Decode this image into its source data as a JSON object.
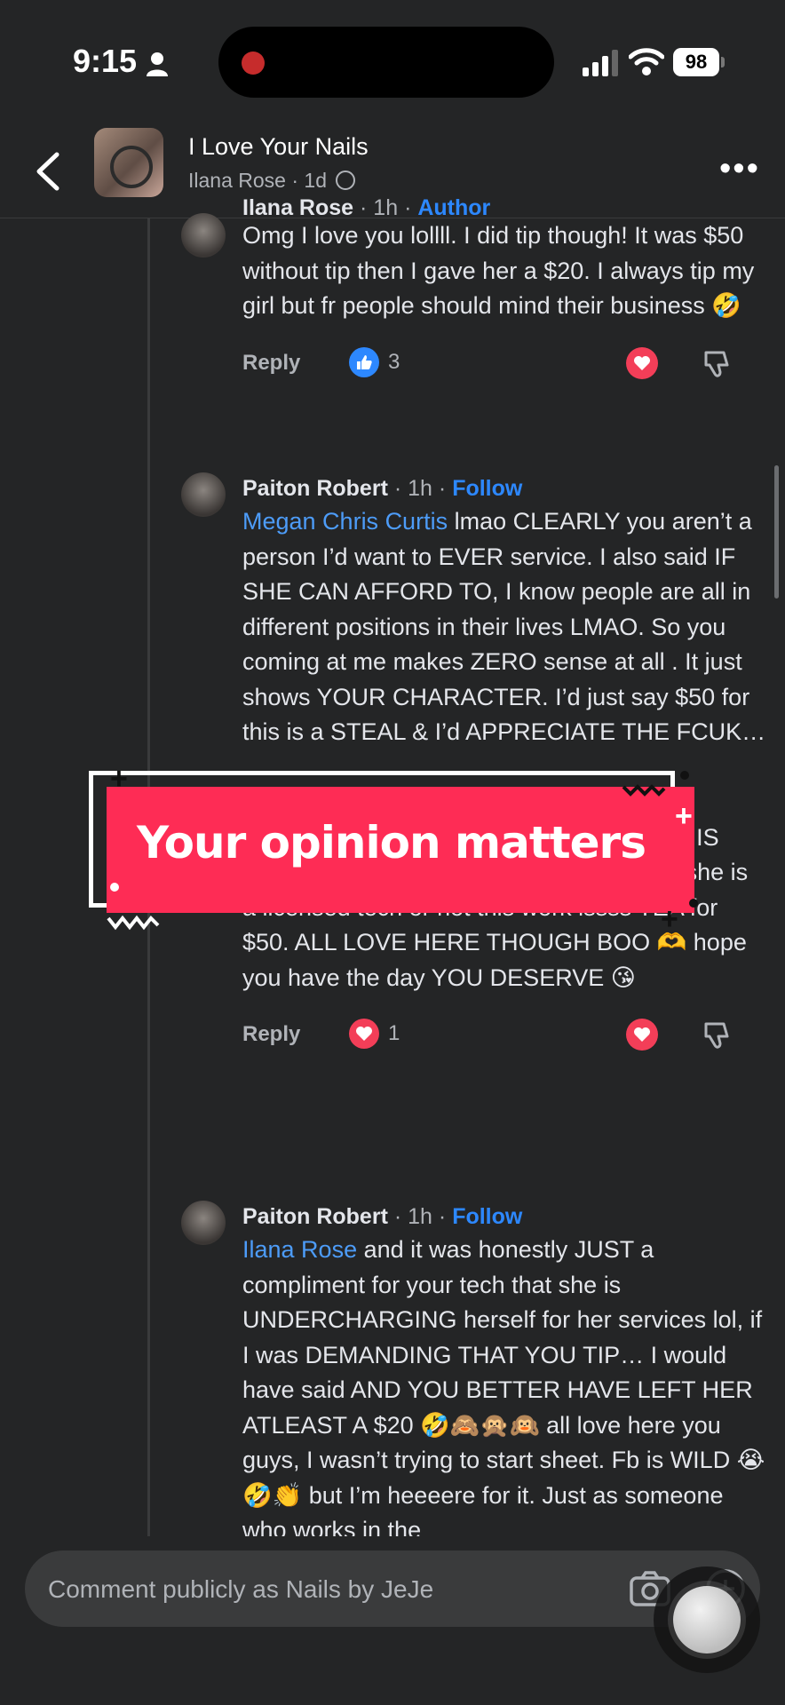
{
  "status_bar": {
    "time": "9:15",
    "battery": "98"
  },
  "header": {
    "title": "I Love Your Nails",
    "author": "Ilana Rose",
    "age": "1d"
  },
  "comments": [
    {
      "author": "Ilana Rose",
      "age": "1h",
      "badge": "Author",
      "text": "Omg I love you lollll. I did tip though! It was $50 without tip then I gave her a $20. I always tip my girl but fr people should mind their business 🤣",
      "reply_label": "Reply",
      "reaction_count": "3"
    },
    {
      "author": "Paiton Robert",
      "age": "1h",
      "follow": "Follow",
      "mention": "Megan Chris Curtis",
      "text": " lmao CLEARLY you aren’t a person I’d want to EVER service. I also said IF SHE CAN AFFORD TO, I know people are all in different positions in their lives LMAO. So you coming at me makes ZERO sense at all . It just shows YOUR CHARACTER. I’d just say $50 for this is a STEAL & I’d APPRECIATE THE FCUK…",
      "text_after": "EVERYONE IN THIS GROUP KNOWS THIS WAS UNDERCHARGED… regardless IF she is a licensed tech or not this work issss TEA for $50. ALL LOVE HERE THOUGH BOO 🫶 hope you have the day YOU DESERVE 😘",
      "reply_label": "Reply",
      "reaction_count": "1"
    },
    {
      "author": "Paiton Robert",
      "age": "1h",
      "follow": "Follow",
      "mention": "Ilana Rose",
      "text": " and it was honestly JUST a compliment for your tech that she is UNDERCHARGING herself for her services lol, if I was DEMANDING THAT YOU TIP… I would have said AND YOU BETTER HAVE LEFT HER ATLEAST A $20 🤣🙈🙊🙉 all love here you guys, I wasn’t trying to start sheet. Fb is WILD 😭🤣👏 but I’m heeeere for it. Just as someone who works in the"
    }
  ],
  "overlay": {
    "text": "Your opinion matters"
  },
  "composer": {
    "placeholder": "Comment publicly as Nails by JeJe"
  },
  "icons": {
    "like": "thumbs-up-icon",
    "love": "heart-icon",
    "dislike": "thumbs-down-icon",
    "camera": "camera-icon",
    "add": "plus-icon",
    "back": "chevron-left-icon",
    "more": "more-dots-icon"
  },
  "colors": {
    "link": "#4d9cf8",
    "follow": "#2d88ff",
    "love": "#f33e58",
    "banner": "#fe2c55"
  }
}
